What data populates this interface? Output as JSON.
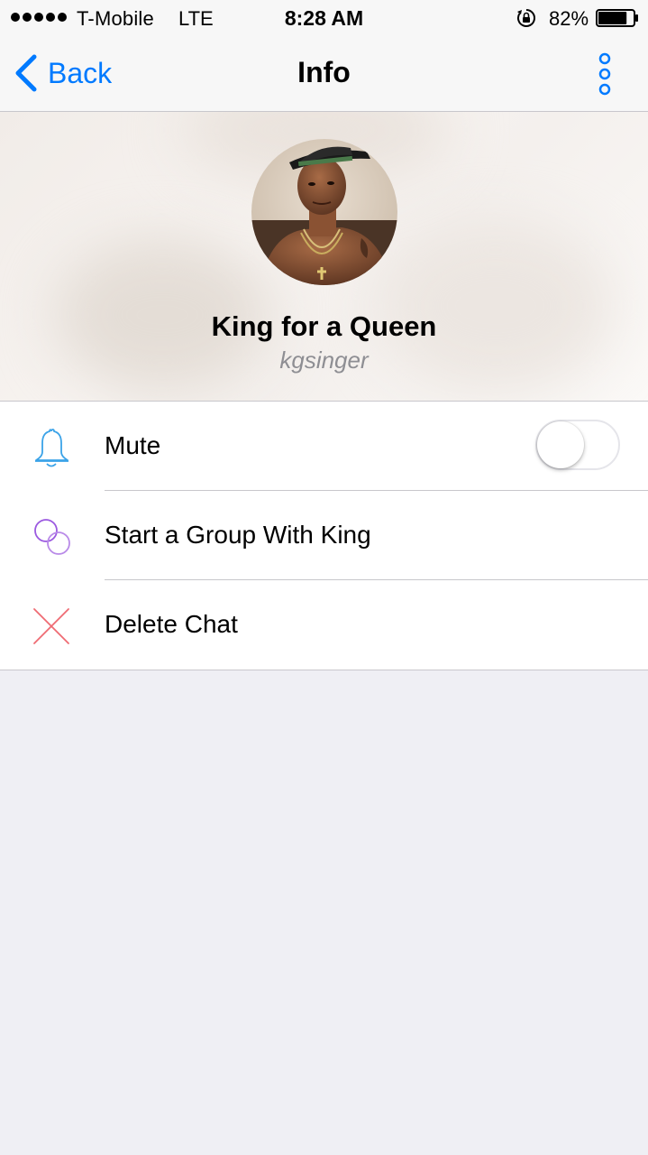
{
  "status_bar": {
    "carrier": "T-Mobile",
    "network": "LTE",
    "time": "8:28 AM",
    "battery_percent": "82%",
    "battery_level": 0.82,
    "signal_bars": 5,
    "icons": [
      "signal-dots-icon",
      "orientation-lock-icon",
      "battery-icon"
    ]
  },
  "nav_bar": {
    "back_label": "Back",
    "title": "Info",
    "icons": [
      "chevron-left-icon",
      "more-vertical-icon"
    ]
  },
  "profile": {
    "name": "King for a Queen",
    "username": "kgsinger"
  },
  "settings": {
    "items": [
      {
        "label": "Mute",
        "icon": "bell-icon",
        "toggle": false
      },
      {
        "label": "Start a Group With King",
        "icon": "group-circles-icon"
      },
      {
        "label": "Delete Chat",
        "icon": "close-x-icon"
      }
    ]
  },
  "colors": {
    "accent": "#007aff",
    "bell_icon": "#3ba3e8",
    "group_icon": "#a566e0",
    "delete_icon": "#ef6b73",
    "background": "#efeff4"
  }
}
